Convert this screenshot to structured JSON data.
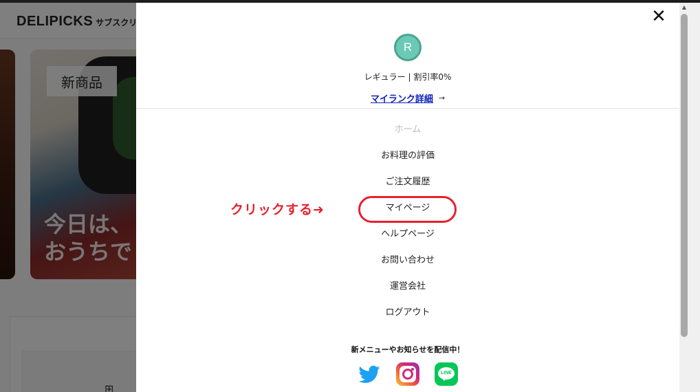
{
  "background": {
    "logo": "DELIPICKS",
    "logo_sub": "サブスクリ",
    "banner_badge": "新商品",
    "banner_overlay_line1": "今日は、",
    "banner_overlay_line2": "おうちで"
  },
  "drawer": {
    "close_label": "✕",
    "avatar_letter": "R",
    "rank_text": "レギュラー | 割引率0%",
    "rank_link": "マイランク詳細",
    "rank_arrow": "→",
    "menu": [
      {
        "label": "ホーム",
        "disabled": true
      },
      {
        "label": "お料理の評価",
        "disabled": false
      },
      {
        "label": "ご注文履歴",
        "disabled": false
      },
      {
        "label": "マイページ",
        "disabled": false
      },
      {
        "label": "ヘルプページ",
        "disabled": false
      },
      {
        "label": "お問い合わせ",
        "disabled": false
      },
      {
        "label": "運営会社",
        "disabled": false
      },
      {
        "label": "ログアウト",
        "disabled": false
      }
    ],
    "sns_title": "新メニューやお知らせを配信中！",
    "sns": [
      "twitter-icon",
      "instagram-icon",
      "line-icon"
    ],
    "line_text": "LINE"
  },
  "annotation": {
    "text": "クリックする➜",
    "color": "#e8202e"
  },
  "colors": {
    "accent": "#6cc9b5",
    "link": "#1020b8",
    "highlight": "#e8202e"
  }
}
